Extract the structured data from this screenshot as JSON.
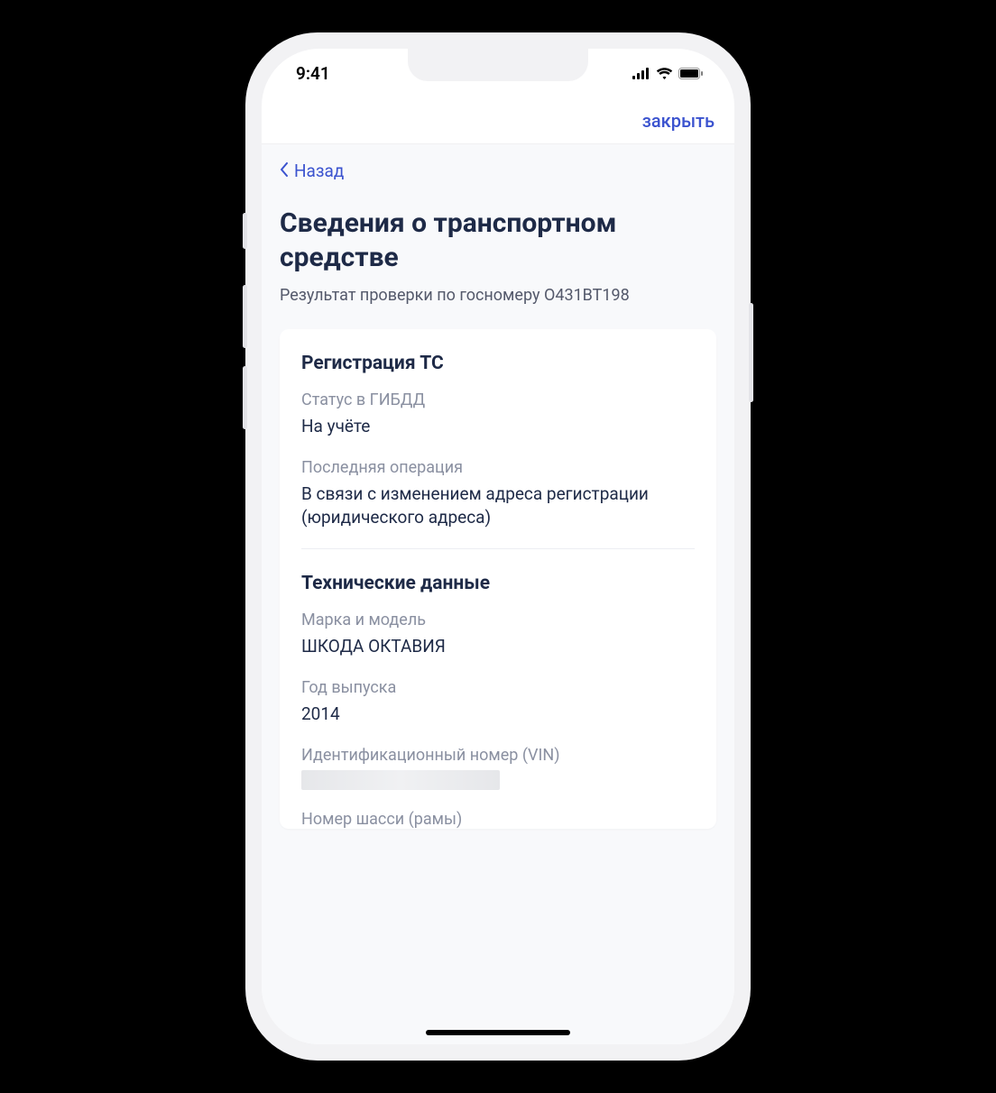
{
  "status_bar": {
    "time": "9:41"
  },
  "nav": {
    "close_label": "закрыть",
    "back_label": "Назад"
  },
  "header": {
    "title": "Сведения о транспортном средстве",
    "subtitle": "Результат проверки по госномеру О431ВТ198"
  },
  "sections": {
    "registration": {
      "title": "Регистрация ТС",
      "status_label": "Статус в ГИБДД",
      "status_value": "На учёте",
      "last_op_label": "Последняя операция",
      "last_op_value": "В связи с изменением адреса регистрации (юридического адреса)"
    },
    "technical": {
      "title": "Технические данные",
      "make_label": "Марка и модель",
      "make_value": "ШКОДА ОКТАВИЯ",
      "year_label": "Год выпуска",
      "year_value": "2014",
      "vin_label": "Идентификационный номер (VIN)",
      "chassis_label": "Номер шасси (рамы)"
    }
  }
}
